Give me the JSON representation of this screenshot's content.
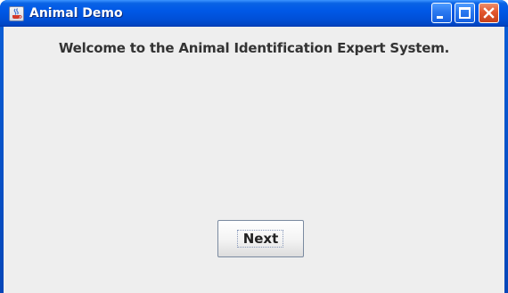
{
  "window": {
    "title": "Animal Demo",
    "app_icon": "java-cup-icon",
    "controls": {
      "minimize_icon": "minimize-icon",
      "maximize_icon": "maximize-icon",
      "close_icon": "close-icon"
    },
    "colors": {
      "titlebar": "#0058e6",
      "client_background": "#eeeeee",
      "close_button": "#e2562d"
    }
  },
  "content": {
    "welcome_text": "Welcome to the Animal Identification Expert System.",
    "next_label": "Next"
  }
}
